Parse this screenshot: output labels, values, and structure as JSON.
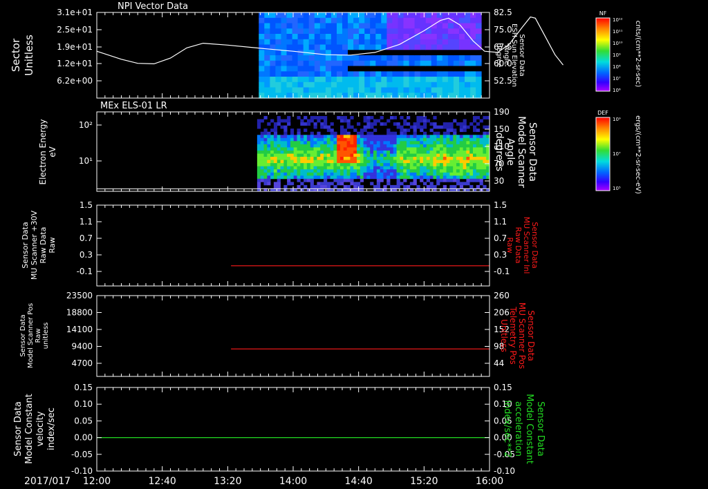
{
  "date_label": "2017/017",
  "time_axis": {
    "ticks": [
      "12:00",
      "12:40",
      "13:20",
      "14:00",
      "14:40",
      "15:20",
      "16:00"
    ],
    "range": [
      "12:00",
      "16:00"
    ]
  },
  "colors": {
    "background": "#000000",
    "axis": "#ffffff",
    "red_trace": "#ff1a1a",
    "green_trace": "#22dd22"
  },
  "colorbars": [
    {
      "tag": "NF",
      "tick_labels": [
        "10¹²",
        "10¹¹",
        "10¹⁰",
        "10⁹",
        "10⁸",
        "10⁷",
        "10⁶"
      ],
      "unit_label": "cnts/(cm**2-sr-sec)"
    },
    {
      "tag": "DEF",
      "tick_labels": [
        "10⁹",
        "10⁷",
        "10⁵"
      ],
      "unit_label": "ergs/(cm**2-sr-sec-eV)"
    }
  ],
  "chart_data": [
    {
      "type": "heatmap",
      "title": "NPI Vector Data",
      "ylabel_left": [
        "Sector",
        "Unitless"
      ],
      "yticks_left": [
        "3.1e+01",
        "2.5e+01",
        "1.9e+01",
        "1.2e+01",
        "6.2e+00"
      ],
      "ylabel_right": [
        "Sensor Data",
        "ESH Sun Elevation",
        "Angle",
        "degree"
      ],
      "yticks_right": [
        "82.5",
        "75.0",
        "67.5",
        "60.0",
        "52.5"
      ],
      "ylim_right": [
        45,
        82.5
      ],
      "data_start": "13:39",
      "data_end": "15:55",
      "overlay_line": {
        "name": "ESH Sun Elevation Angle",
        "color": "#ffffff",
        "points": [
          [
            "12:00",
            65.5
          ],
          [
            "12:15",
            62.0
          ],
          [
            "12:25",
            60.2
          ],
          [
            "12:35",
            60.0
          ],
          [
            "12:45",
            62.5
          ],
          [
            "12:55",
            67.0
          ],
          [
            "13:05",
            69.0
          ],
          [
            "13:20",
            68.2
          ],
          [
            "13:40",
            66.8
          ],
          [
            "14:00",
            65.5
          ],
          [
            "14:20",
            64.0
          ],
          [
            "14:35",
            63.8
          ],
          [
            "14:50",
            65.0
          ],
          [
            "15:05",
            68.5
          ],
          [
            "15:20",
            74.5
          ],
          [
            "15:30",
            79.0
          ],
          [
            "15:35",
            80.0
          ],
          [
            "15:42",
            77.0
          ],
          [
            "15:50",
            70.0
          ],
          [
            "15:57",
            65.5
          ],
          [
            "16:05",
            65.0
          ],
          [
            "16:12",
            68.5
          ],
          [
            "16:20",
            76.0
          ],
          [
            "16:25",
            80.5
          ],
          [
            "16:28",
            80.0
          ],
          [
            "16:34",
            72.0
          ],
          [
            "16:40",
            64.0
          ],
          [
            "16:45",
            59.5
          ]
        ]
      }
    },
    {
      "type": "heatmap",
      "title": "MEx ELS-01 LR",
      "ylabel_left": [
        "Electron Energy",
        "eV"
      ],
      "yticks_left": [
        "10²",
        "10¹"
      ],
      "ylabel_right": [
        "Sensor Data",
        "Model Scanner",
        "Angle",
        "degrees"
      ],
      "yticks_right": [
        "190",
        "150",
        "110",
        "70",
        "30"
      ],
      "ylim_right": [
        0,
        190
      ],
      "data_start": "13:38",
      "data_end": "16:00",
      "overlay_line": {
        "name": "Model Scanner Angle",
        "color": "#ffffff",
        "points": [
          [
            "12:00",
            6
          ],
          [
            "16:00",
            6
          ]
        ]
      }
    },
    {
      "type": "line",
      "ylabel_left": [
        "Sensor Data",
        "MU Scanner +30V",
        "Raw Data",
        "Raw"
      ],
      "yticks_left": [
        "1.5",
        "1.1",
        "0.7",
        "0.3",
        "-0.1"
      ],
      "ylabel_right": [
        "Sensor Data",
        "MU Scanner Inl",
        "Raw Data",
        "Raw"
      ],
      "yticks_right": [
        "1.5",
        "1.1",
        "0.7",
        "0.3",
        "-0.1"
      ],
      "ylim": [
        -0.5,
        1.5
      ],
      "series": [
        {
          "color": "#ff1a1a",
          "x": [
            "13:22",
            "16:00"
          ],
          "y": [
            0.0,
            0.0
          ]
        }
      ]
    },
    {
      "type": "line",
      "ylabel_left": [
        "Sensor Data",
        "Model Scanner Pos",
        "Raw",
        "unitless"
      ],
      "yticks_left": [
        "23500",
        "18800",
        "14100",
        "9400",
        "4700"
      ],
      "ylabel_right": [
        "Sensor Data",
        "MU Scanner Pos",
        "Telemetry Pos",
        "Unitless"
      ],
      "yticks_right": [
        "260",
        "206",
        "152",
        "98",
        "44"
      ],
      "ylim": [
        0,
        23500
      ],
      "series": [
        {
          "color": "#ff1a1a",
          "x": [
            "13:22",
            "16:00"
          ],
          "y": [
            8000,
            8000
          ]
        }
      ]
    },
    {
      "type": "line",
      "ylabel_left": [
        "Sensor Data",
        "Model Constant",
        "velocity",
        "index/sec"
      ],
      "yticks_left": [
        "0.15",
        "0.10",
        "0.05",
        "0.00",
        "-0.05",
        "-0.10"
      ],
      "ylabel_right": [
        "Sensor Data",
        "Model Constant",
        "acceleration",
        "index/sec**2"
      ],
      "yticks_right": [
        "0.15",
        "0.10",
        "0.05",
        "0.00",
        "-0.05",
        "-0.10"
      ],
      "ylim": [
        -0.1,
        0.15
      ],
      "series": [
        {
          "color": "#22dd22",
          "x": [
            "12:00",
            "16:00"
          ],
          "y": [
            0.0,
            0.0
          ]
        }
      ]
    }
  ]
}
